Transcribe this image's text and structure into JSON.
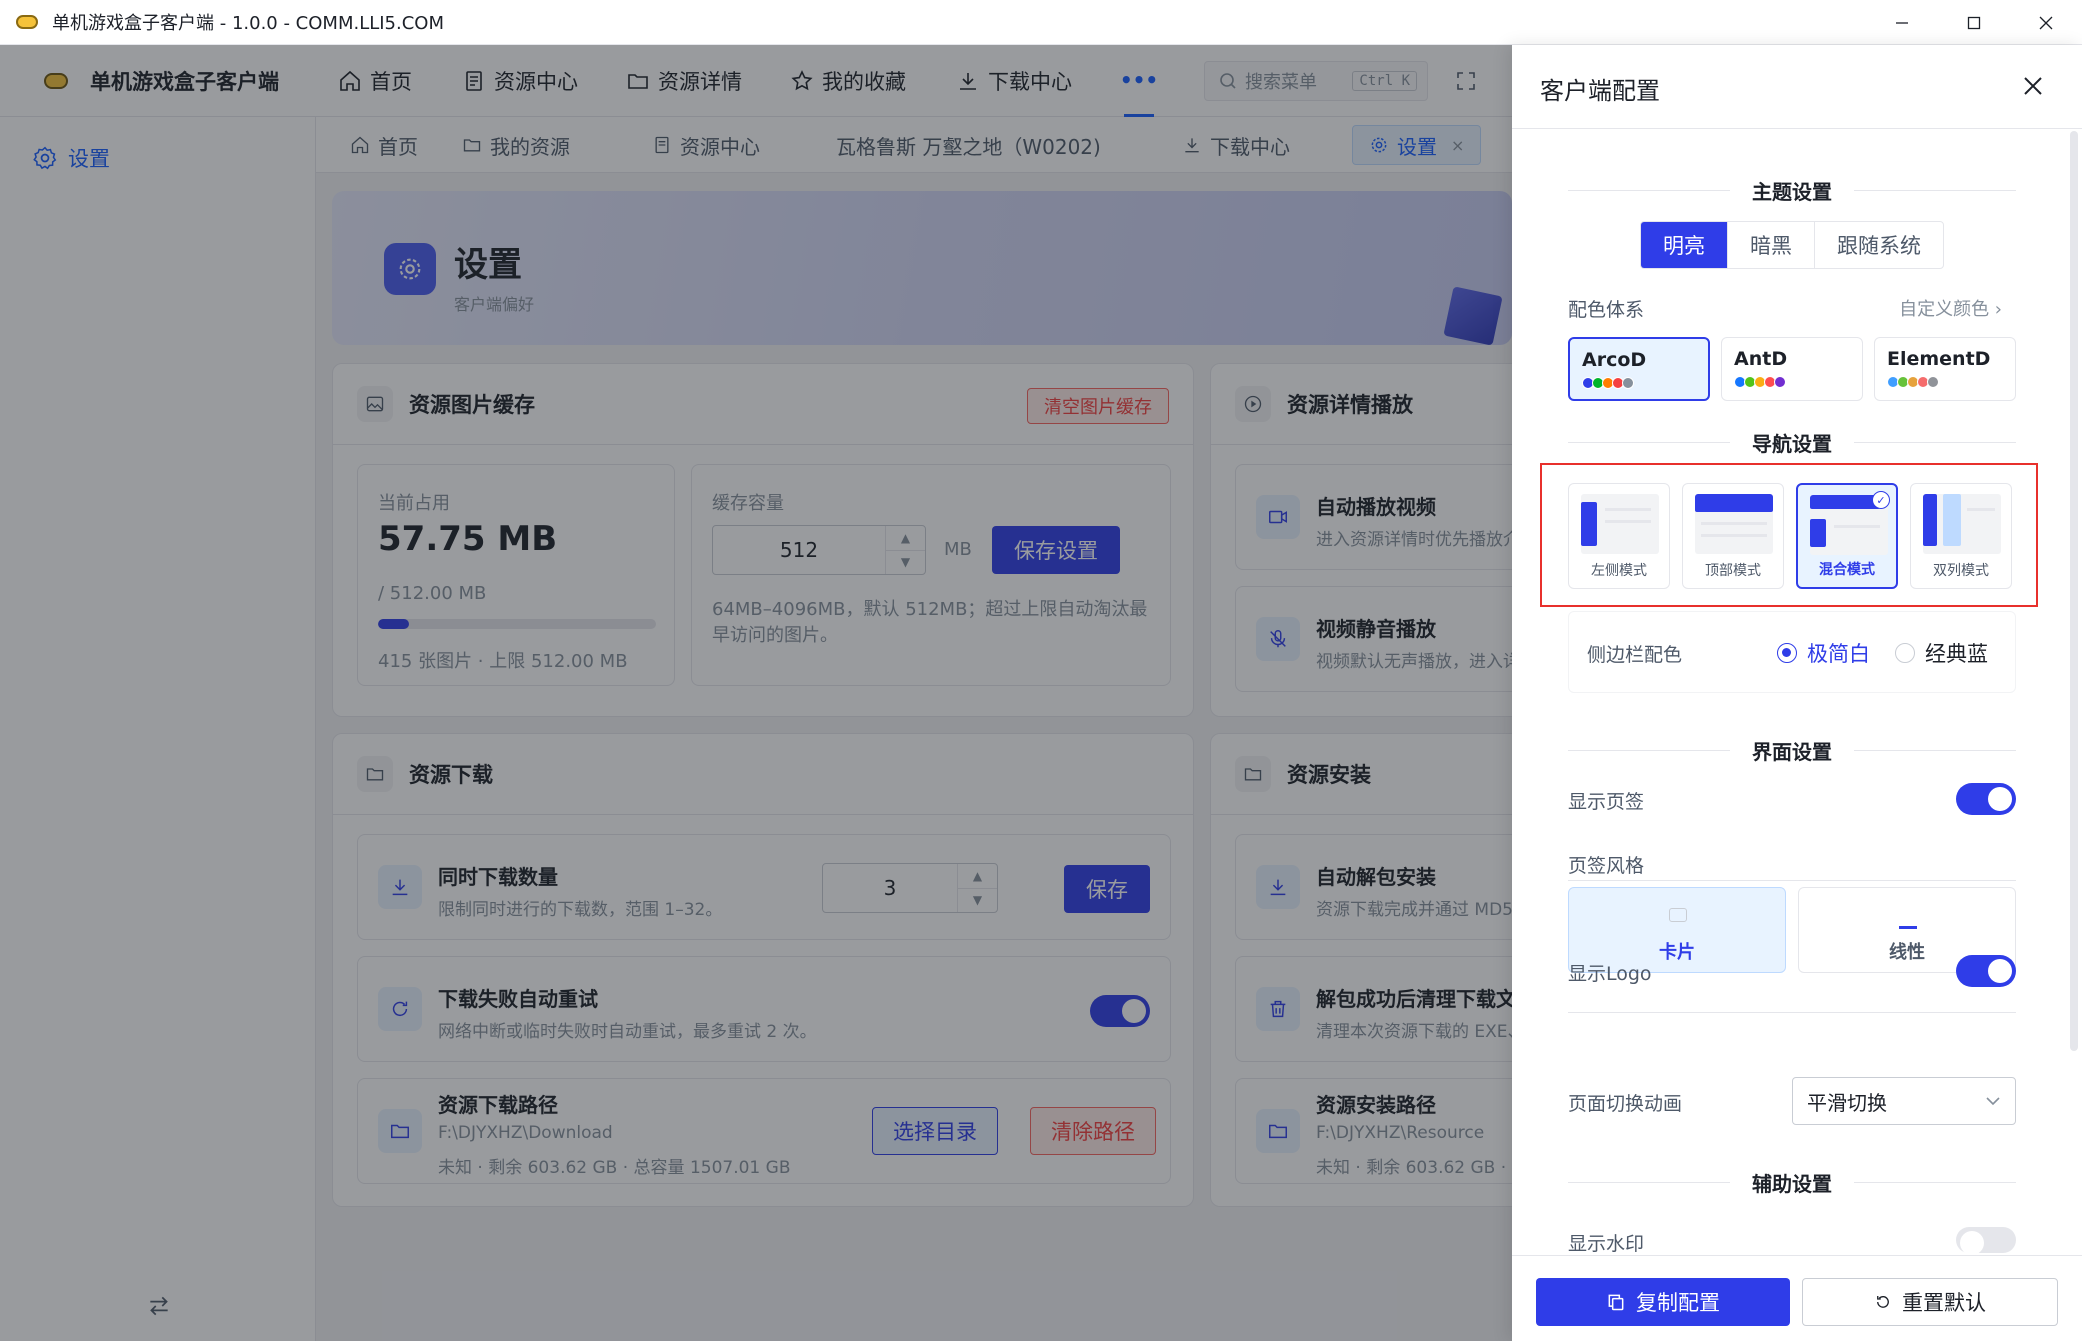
{
  "window": {
    "title": "单机游戏盒子客户端 - 1.0.0 - COMM.LLI5.COM"
  },
  "brand": {
    "name": "单机游戏盒子客户端"
  },
  "topnav": {
    "items": [
      {
        "label": "首页",
        "icon": "home-icon"
      },
      {
        "label": "资源中心",
        "icon": "document-icon"
      },
      {
        "label": "资源详情",
        "icon": "folder-icon"
      },
      {
        "label": "我的收藏",
        "icon": "star-icon"
      },
      {
        "label": "下载中心",
        "icon": "download-icon"
      }
    ],
    "more": "•••",
    "search_placeholder": "搜索菜单",
    "search_shortcut": "Ctrl K"
  },
  "sidebar": {
    "items": [
      {
        "label": "设置",
        "icon": "gear-icon"
      }
    ]
  },
  "tabs": [
    {
      "label": "首页"
    },
    {
      "label": "我的资源"
    },
    {
      "label": "资源中心"
    },
    {
      "label": "瓦格鲁斯 万壑之地（W0202)"
    },
    {
      "label": "下载中心"
    },
    {
      "label": "设置",
      "active": true
    }
  ],
  "banner": {
    "title": "设置",
    "subtitle": "客户端偏好"
  },
  "cache_card": {
    "title": "资源图片缓存",
    "clear_button": "清空图片缓存",
    "current_label": "当前占用",
    "current_value": "57.75 MB",
    "current_total": "/ 512.00 MB",
    "usage_fraction": 0.113,
    "count_text": "415 张图片 · 上限 512.00 MB",
    "capacity_label": "缓存容量",
    "capacity_value": "512",
    "capacity_unit": "MB",
    "save_button": "保存设置",
    "capacity_hint_line1": "64MB–4096MB，默认 512MB；超过上限自动淘汰最",
    "capacity_hint_line2": "早访问的图片。"
  },
  "playback_card": {
    "title": "资源详情播放",
    "rows": [
      {
        "title": "自动播放视频",
        "desc": "进入资源详情时优先播放介"
      },
      {
        "title": "视频静音播放",
        "desc": "视频默认无声播放，进入详"
      }
    ]
  },
  "download_card": {
    "title": "资源下载",
    "concurrent_title": "同时下载数量",
    "concurrent_desc": "限制同时进行的下载数，范围 1–32。",
    "concurrent_value": "3",
    "concurrent_save": "保存",
    "retry_title": "下载失败自动重试",
    "retry_desc": "网络中断或临时失败时自动重试，最多重试 2 次。",
    "retry_enabled": true,
    "path_title": "资源下载路径",
    "path_value": "F:\\DJYXHZ\\Download",
    "path_info": "未知 · 剩余 603.62 GB · 总容量 1507.01 GB",
    "choose_button": "选择目录",
    "clear_button": "清除路径"
  },
  "install_card": {
    "title": "资源安装",
    "rows": [
      {
        "title": "自动解包安装",
        "desc": "资源下载完成并通过 MD5"
      },
      {
        "title": "解包成功后清理下载文",
        "desc": "清理本次资源下载的 EXE、"
      },
      {
        "title": "资源安装路径",
        "desc": "F:\\DJYXHZ\\Resource",
        "desc2": "未知 · 剩余 603.62 GB · 总"
      }
    ]
  },
  "panel": {
    "title": "客户端配置",
    "theme_section": "主题设置",
    "theme_options": [
      "明亮",
      "暗黑",
      "跟随系统"
    ],
    "theme_selected": "明亮",
    "color_scheme_label": "配色体系",
    "custom_color_link": "自定义颜色",
    "color_schemes": [
      {
        "name": "ArcoD",
        "colors": [
          "#2f3de8",
          "#00b42a",
          "#ff7d00",
          "#f53f3f",
          "#86909c"
        ]
      },
      {
        "name": "AntD",
        "colors": [
          "#1677ff",
          "#52c41a",
          "#faad14",
          "#ff4d4f",
          "#722ed1"
        ]
      },
      {
        "name": "ElementD",
        "colors": [
          "#409eff",
          "#67c23a",
          "#e6a23c",
          "#f56c6c",
          "#909399"
        ]
      }
    ],
    "color_scheme_selected": "ArcoD",
    "nav_section": "导航设置",
    "nav_modes": [
      "左侧模式",
      "顶部模式",
      "混合模式",
      "双列模式"
    ],
    "nav_mode_selected": "混合模式",
    "sidebar_color_label": "侧边栏配色",
    "sidebar_color_options": [
      "极简白",
      "经典蓝"
    ],
    "sidebar_color_selected": "极简白",
    "ui_section": "界面设置",
    "show_tabs_label": "显示页签",
    "show_tabs": true,
    "tab_style_label": "页签风格",
    "tab_styles": [
      "卡片",
      "线性"
    ],
    "tab_style_selected": "卡片",
    "show_logo_label": "显示Logo",
    "show_logo": true,
    "page_anim_label": "页面切换动画",
    "page_anim_value": "平滑切换",
    "assist_section": "辅助设置",
    "watermark_label": "显示水印",
    "watermark": false,
    "copy_button": "复制配置",
    "reset_button": "重置默认"
  }
}
